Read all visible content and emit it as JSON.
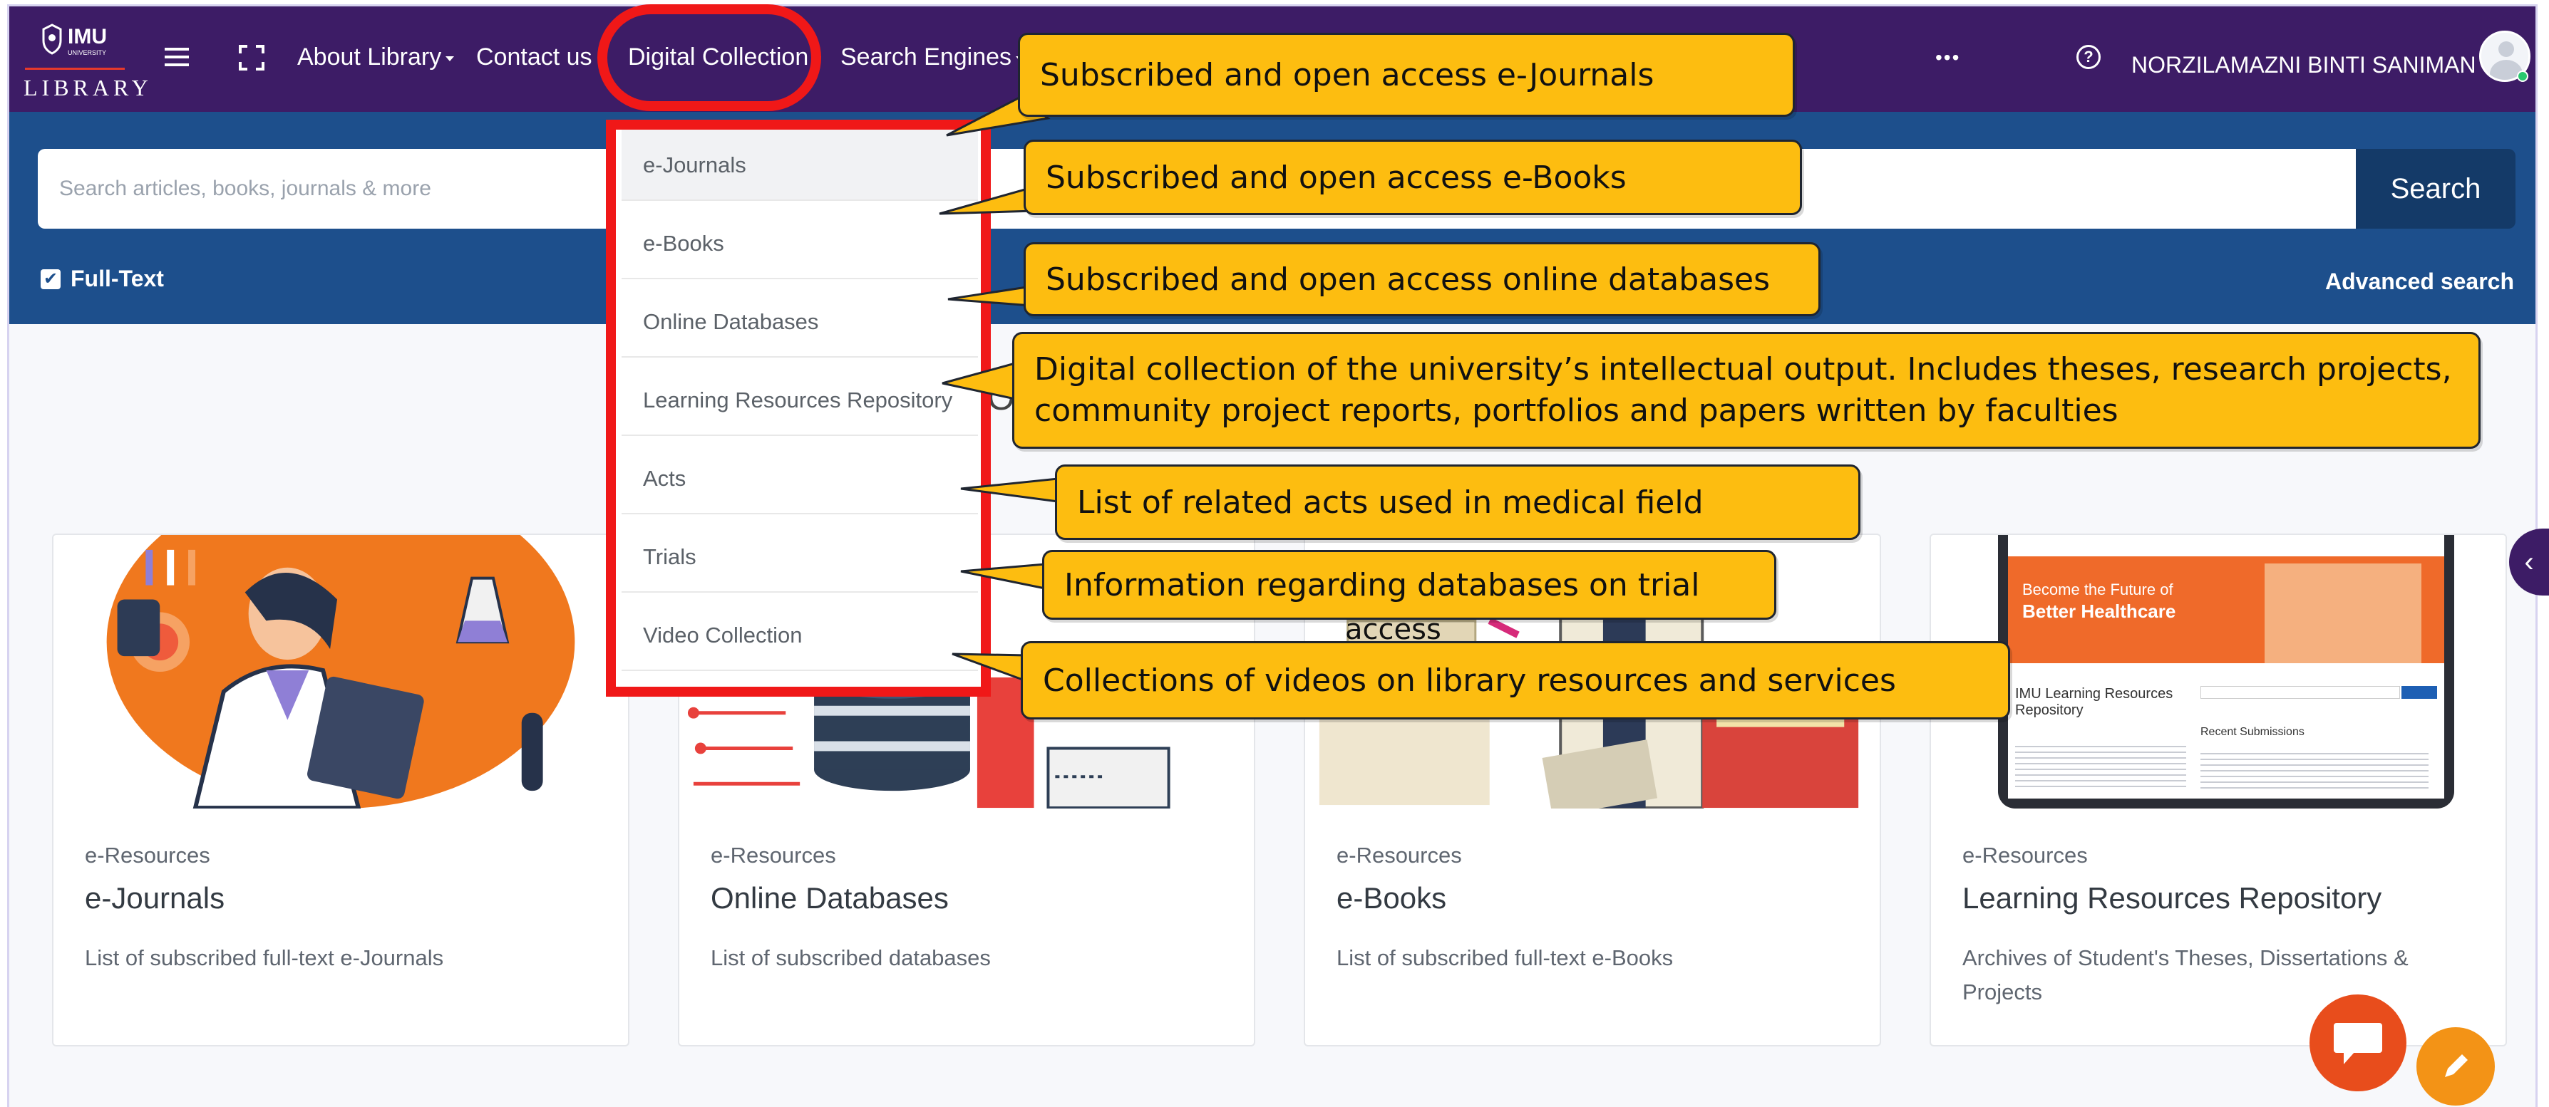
{
  "header": {
    "logo_text": "IMU",
    "logo_sub": "UNIVERSITY",
    "logo_library": "LIBRARY",
    "nav": [
      {
        "label": "About Library"
      },
      {
        "label": "Contact us"
      },
      {
        "label": "Digital Collection"
      },
      {
        "label": "Search Engines"
      }
    ],
    "more": "•••",
    "help": "?",
    "user_name": "NORZILAMAZNI BINTI SANIMAN"
  },
  "search": {
    "placeholder": "Search articles, books, journals & more",
    "button_label": "Search",
    "fulltext_label": "Full-Text",
    "fulltext_checked": true,
    "advanced_label": "Advanced search"
  },
  "dropdown": {
    "items": [
      {
        "label": "e-Journals",
        "active": true
      },
      {
        "label": "e-Books"
      },
      {
        "label": "Online Databases"
      },
      {
        "label": "Learning Resources Repository"
      },
      {
        "label": "Acts"
      },
      {
        "label": "Trials"
      },
      {
        "label": "Video Collection"
      }
    ]
  },
  "callouts": [
    "Subscribed and open access e-Journals",
    "Subscribed and open access e-Books",
    "Subscribed and open access online databases",
    "Digital collection of the university’s intellectual output. Includes theses, research projects, community project reports, portfolios and papers written by faculties",
    "List of related acts used in medical field",
    "Information regarding databases on trial",
    "Collections of videos on library resources and services"
  ],
  "background_text": {
    "partial_heading": "O",
    "partial_access": "access"
  },
  "cards": [
    {
      "category": "e-Resources",
      "title": "e-Journals",
      "description": "List of subscribed full-text e-Journals"
    },
    {
      "category": "e-Resources",
      "title": "Online Databases",
      "description": "List of subscribed databases"
    },
    {
      "category": "e-Resources",
      "title": "e-Books",
      "description": "List of subscribed full-text e-Books"
    },
    {
      "category": "e-Resources",
      "title": "Learning Resources Repository",
      "description": "Archives of Student's Theses, Dissertations & Projects"
    }
  ],
  "card4_screenshot": {
    "banner_line1": "Become the Future of",
    "banner_line2": "Better Healthcare",
    "repo_title": "IMU Learning Resources Repository",
    "recent": "Recent Submissions"
  },
  "colors": {
    "navbar": "#3d1c66",
    "search_band": "#1d4f8c",
    "highlight": "#f01818",
    "callout": "#fdbd10",
    "chat_button": "#e84d1c",
    "edit_button": "#f39316"
  }
}
